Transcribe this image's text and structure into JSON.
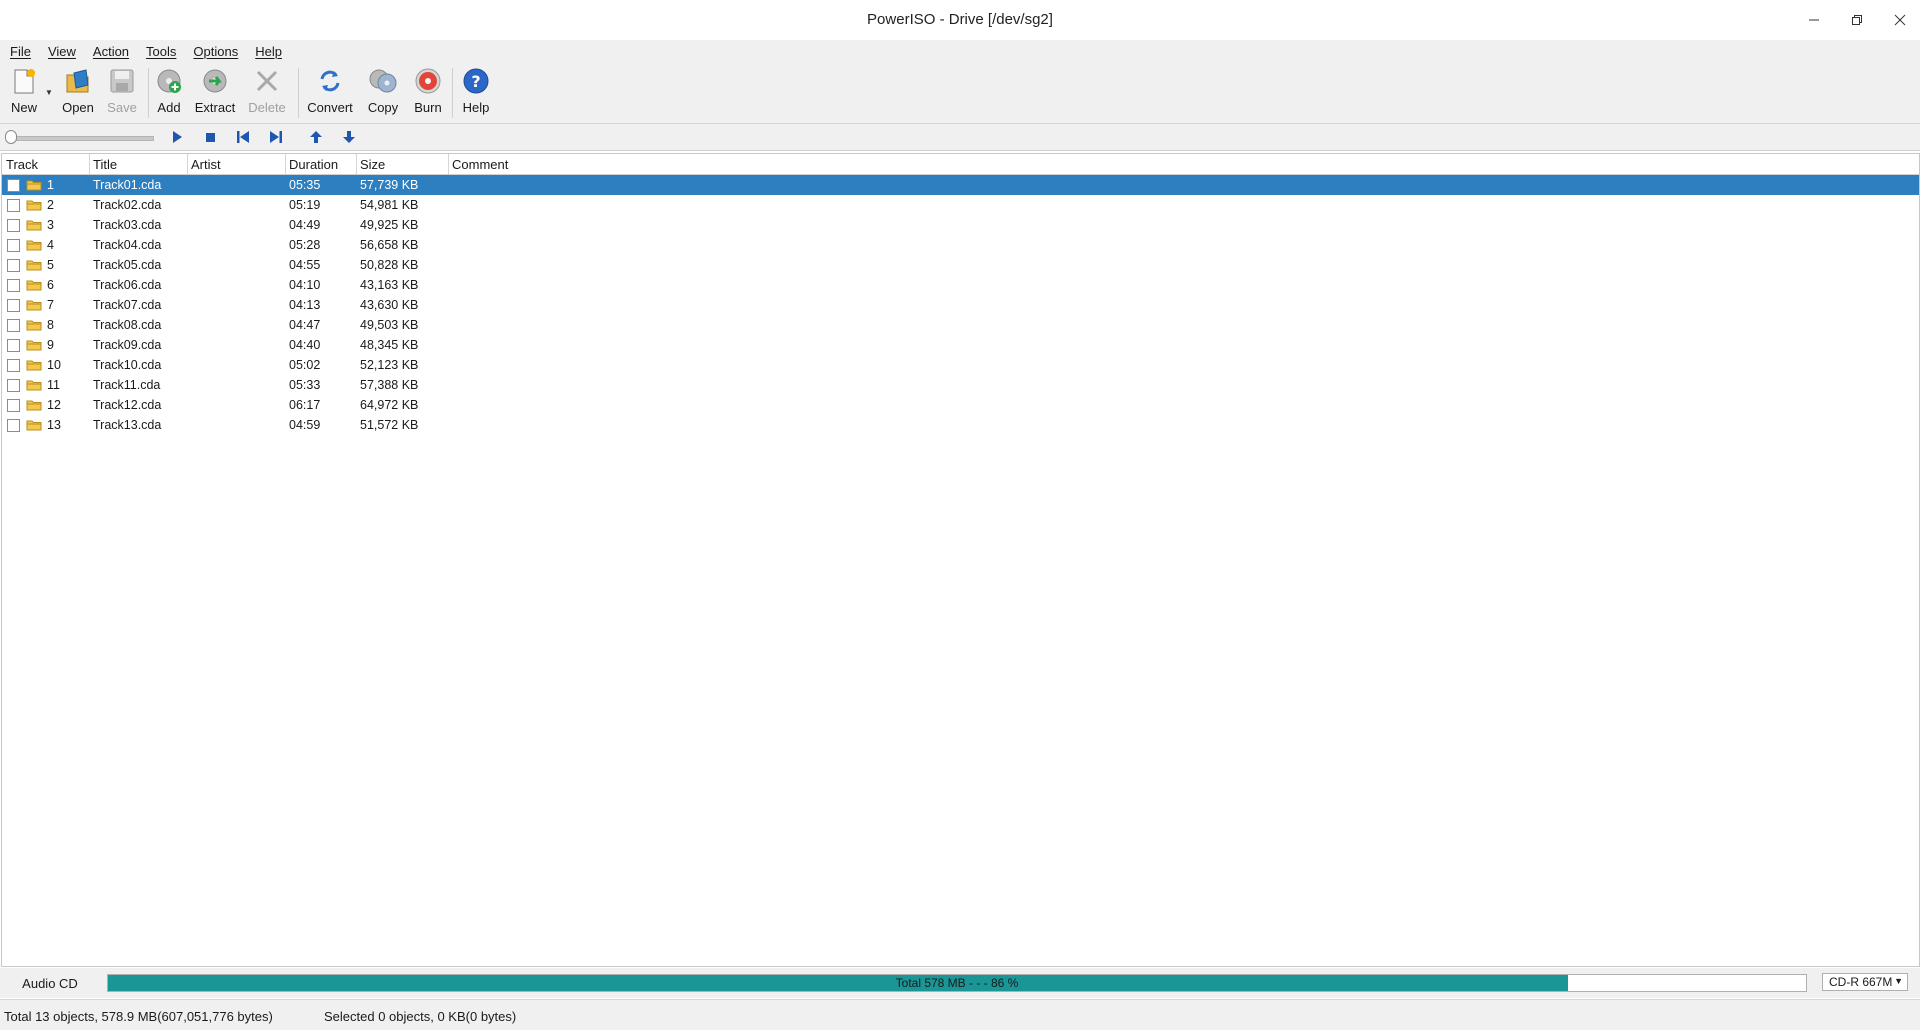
{
  "window": {
    "title": "PowerISO - Drive [/dev/sg2]"
  },
  "menu": {
    "items": [
      "File",
      "View",
      "Action",
      "Tools",
      "Options",
      "Help"
    ]
  },
  "toolbar": {
    "new_label": "New",
    "open_label": "Open",
    "save_label": "Save",
    "add_label": "Add",
    "extract_label": "Extract",
    "delete_label": "Delete",
    "convert_label": "Convert",
    "copy_label": "Copy",
    "burn_label": "Burn",
    "help_label": "Help"
  },
  "table": {
    "columns": {
      "track": "Track",
      "title": "Title",
      "artist": "Artist",
      "duration": "Duration",
      "size": "Size",
      "comment": "Comment"
    },
    "rows": [
      {
        "track": "1",
        "title": "Track01.cda",
        "artist": "",
        "duration": "05:35",
        "size": "57,739 KB",
        "comment": ""
      },
      {
        "track": "2",
        "title": "Track02.cda",
        "artist": "",
        "duration": "05:19",
        "size": "54,981 KB",
        "comment": ""
      },
      {
        "track": "3",
        "title": "Track03.cda",
        "artist": "",
        "duration": "04:49",
        "size": "49,925 KB",
        "comment": ""
      },
      {
        "track": "4",
        "title": "Track04.cda",
        "artist": "",
        "duration": "05:28",
        "size": "56,658 KB",
        "comment": ""
      },
      {
        "track": "5",
        "title": "Track05.cda",
        "artist": "",
        "duration": "04:55",
        "size": "50,828 KB",
        "comment": ""
      },
      {
        "track": "6",
        "title": "Track06.cda",
        "artist": "",
        "duration": "04:10",
        "size": "43,163 KB",
        "comment": ""
      },
      {
        "track": "7",
        "title": "Track07.cda",
        "artist": "",
        "duration": "04:13",
        "size": "43,630 KB",
        "comment": ""
      },
      {
        "track": "8",
        "title": "Track08.cda",
        "artist": "",
        "duration": "04:47",
        "size": "49,503 KB",
        "comment": ""
      },
      {
        "track": "9",
        "title": "Track09.cda",
        "artist": "",
        "duration": "04:40",
        "size": "48,345 KB",
        "comment": ""
      },
      {
        "track": "10",
        "title": "Track10.cda",
        "artist": "",
        "duration": "05:02",
        "size": "52,123 KB",
        "comment": ""
      },
      {
        "track": "11",
        "title": "Track11.cda",
        "artist": "",
        "duration": "05:33",
        "size": "57,388 KB",
        "comment": ""
      },
      {
        "track": "12",
        "title": "Track12.cda",
        "artist": "",
        "duration": "06:17",
        "size": "64,972 KB",
        "comment": ""
      },
      {
        "track": "13",
        "title": "Track13.cda",
        "artist": "",
        "duration": "04:59",
        "size": "51,572 KB",
        "comment": ""
      }
    ],
    "selected_index": 0
  },
  "capacity": {
    "disc_type": "Audio CD",
    "total_text": "Total  578 MB   - - -  86 %",
    "percent": 86,
    "media": "CD-R  667M"
  },
  "status": {
    "total": "Total 13 objects, 578.9 MB(607,051,776 bytes)",
    "selected": "Selected 0 objects, 0 KB(0 bytes)"
  },
  "colors": {
    "selection": "#2e7fc0",
    "progress": "#1a9696"
  }
}
